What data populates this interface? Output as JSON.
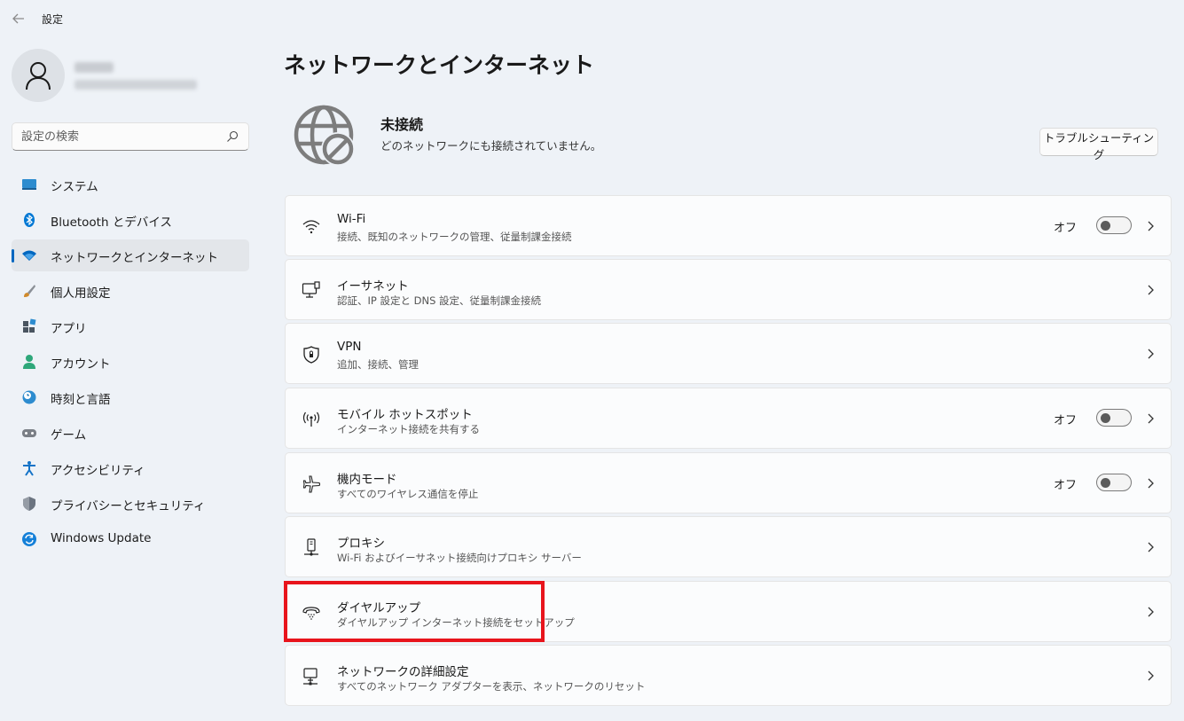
{
  "window": {
    "title": "設定"
  },
  "sidebar": {
    "search_placeholder": "設定の検索",
    "items": [
      {
        "label": "システム",
        "icon": "system-icon",
        "color": "#2d8ccf"
      },
      {
        "label": "Bluetooth とデバイス",
        "icon": "bluetooth-icon",
        "color": "#0078d4"
      },
      {
        "label": "ネットワークとインターネット",
        "icon": "wifi-icon",
        "color": "#0067c0",
        "active": true
      },
      {
        "label": "個人用設定",
        "icon": "brush-icon",
        "color": "#d08a2c"
      },
      {
        "label": "アプリ",
        "icon": "apps-icon",
        "color": "#4a5560"
      },
      {
        "label": "アカウント",
        "icon": "account-icon",
        "color": "#2ea77a"
      },
      {
        "label": "時刻と言語",
        "icon": "clock-globe-icon",
        "color": "#2d8ccf"
      },
      {
        "label": "ゲーム",
        "icon": "gamepad-icon",
        "color": "#7a7f86"
      },
      {
        "label": "アクセシビリティ",
        "icon": "accessibility-icon",
        "color": "#1473c7"
      },
      {
        "label": "プライバシーとセキュリティ",
        "icon": "shield-icon",
        "color": "#6b7480"
      },
      {
        "label": "Windows Update",
        "icon": "update-icon",
        "color": "#1580d8"
      }
    ]
  },
  "main": {
    "title": "ネットワークとインターネット",
    "status": {
      "title": "未接続",
      "description": "どのネットワークにも接続されていません。",
      "troubleshoot_label": "トラブルシューティング"
    },
    "cards": [
      {
        "title": "Wi-Fi",
        "subtitle": "接続、既知のネットワークの管理、従量制課金接続",
        "icon": "wifi-icon",
        "toggle": "オフ"
      },
      {
        "title": "イーサネット",
        "subtitle": "認証、IP 設定と DNS 設定、従量制課金接続",
        "icon": "ethernet-icon"
      },
      {
        "title": "VPN",
        "subtitle": "追加、接続、管理",
        "icon": "vpn-shield-icon"
      },
      {
        "title": "モバイル ホットスポット",
        "subtitle": "インターネット接続を共有する",
        "icon": "hotspot-icon",
        "toggle": "オフ"
      },
      {
        "title": "機内モード",
        "subtitle": "すべてのワイヤレス通信を停止",
        "icon": "airplane-icon",
        "toggle": "オフ"
      },
      {
        "title": "プロキシ",
        "subtitle": "Wi-Fi およびイーサネット接続向けプロキシ サーバー",
        "icon": "proxy-icon"
      },
      {
        "title": "ダイヤルアップ",
        "subtitle": "ダイヤルアップ インターネット接続をセットアップ",
        "icon": "dialup-icon"
      },
      {
        "title": "ネットワークの詳細設定",
        "subtitle": "すべてのネットワーク アダプターを表示、ネットワークのリセット",
        "icon": "advanced-network-icon"
      }
    ]
  },
  "colors": {
    "accent": "#0067c0",
    "highlight": "#e8141c"
  }
}
